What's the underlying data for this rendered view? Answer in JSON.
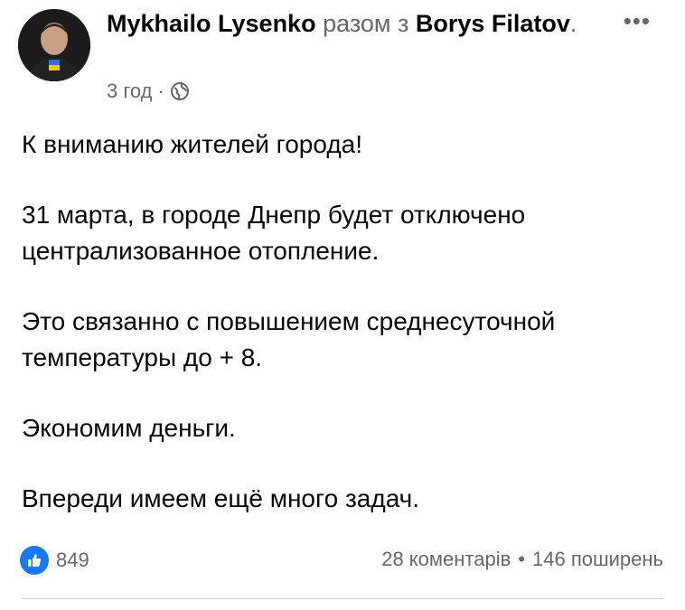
{
  "post": {
    "author": "Mykhailo Lysenko",
    "with_text": "разом з",
    "coauthor": "Borys Filatov",
    "coauthor_suffix": ".",
    "time": "3 год",
    "meta_sep": "·",
    "privacy_icon": "globe-icon",
    "more_icon": "•••",
    "paragraphs": [
      "К вниманию жителей города!",
      "31 марта, в городе Днепр будет отключено централизованное отопление.",
      "Это связанно с повышением среднесуточной температуры до + 8.",
      "Экономим деньги.",
      "Впереди имеем ещё много задач."
    ],
    "reactions_count": "849",
    "comments": "28 коментарів",
    "stats_sep": "•",
    "shares": "146 поширень"
  },
  "colors": {
    "text": "#050505",
    "secondary": "#65676b",
    "like_blue": "#1877f2",
    "divider": "#ced0d4"
  }
}
